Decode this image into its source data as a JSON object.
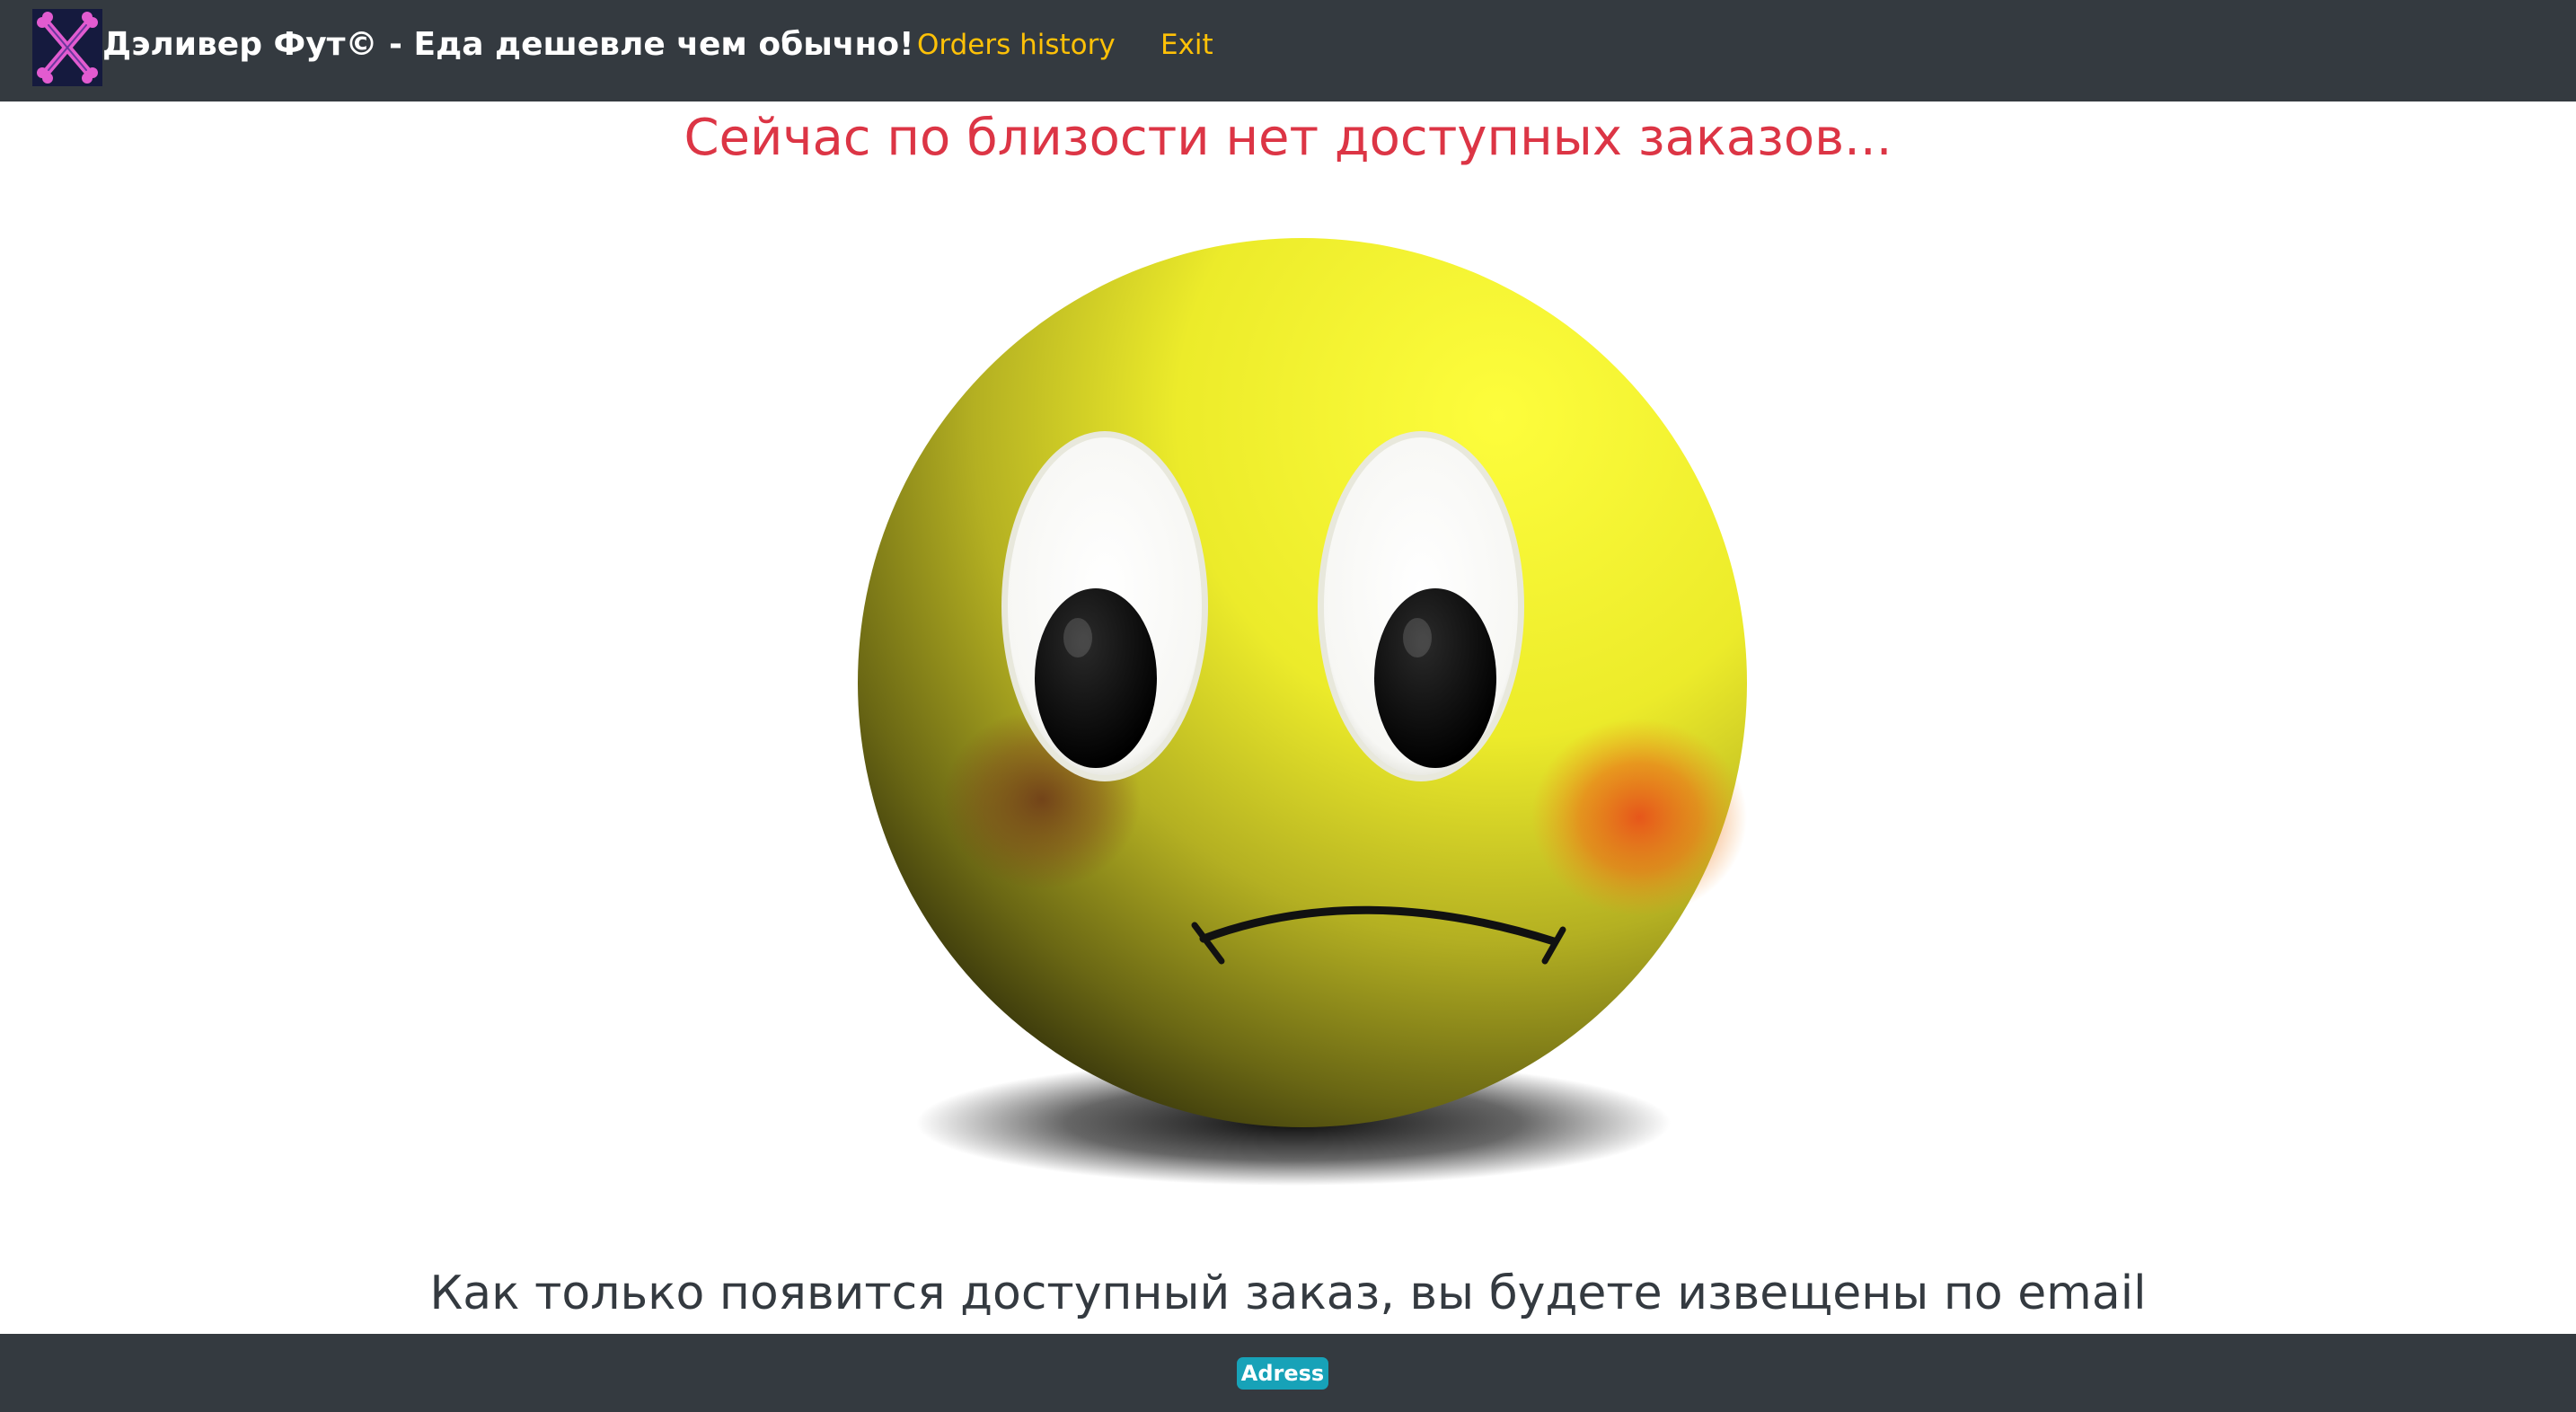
{
  "header": {
    "brand_title": "Дэливер Фут© - Еда дешевле чем обычно!",
    "logo_icon": "crossed-bones-logo-icon",
    "nav": {
      "orders_history": "Orders history",
      "exit": "Exit"
    }
  },
  "main": {
    "headline": "Сейчас по близости нет доступных заказов...",
    "picture": "sad-face-emoji",
    "notice": "Как только появится доступный заказ, вы будете извещены по email"
  },
  "footer": {
    "address_badge": "Adress"
  },
  "colors": {
    "navbar_bg": "#343a40",
    "nav_link": "#ffc107",
    "headline": "#dc3545",
    "notice": "#343a40",
    "badge_bg": "#17a2b8"
  }
}
